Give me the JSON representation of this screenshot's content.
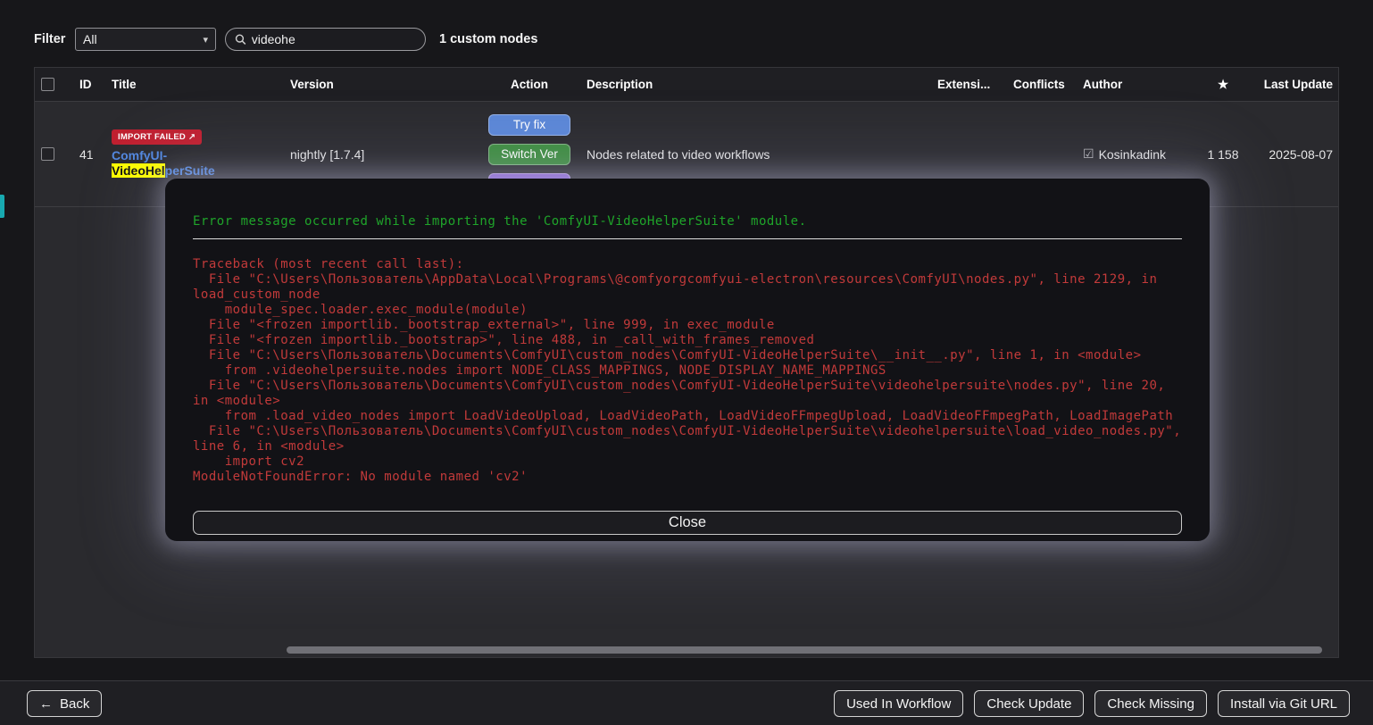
{
  "topbar": {
    "filter_label": "Filter",
    "filter_value": "All",
    "search_value": "videohe",
    "count_text": "1 custom nodes"
  },
  "table": {
    "headers": {
      "id": "ID",
      "title": "Title",
      "version": "Version",
      "action": "Action",
      "description": "Description",
      "extension": "Extensi...",
      "conflicts": "Conflicts",
      "author": "Author",
      "star": "★",
      "last_update": "Last Update"
    },
    "row": {
      "id": "41",
      "badge_label": "IMPORT FAILED",
      "badge_icon": "↗",
      "title_prefix": "ComfyUI-",
      "title_match": "VideoHel",
      "title_suffix": "perSuite",
      "version": "nightly [1.7.4]",
      "action_fix": "Try fix",
      "action_switch": "Switch Ver",
      "description": "Nodes related to video workflows",
      "author_check": "☑",
      "author": "Kosinkadink",
      "stars": "1 158",
      "last_update": "2025-08-07"
    }
  },
  "modal": {
    "error_title": "Error message occurred while importing the 'ComfyUI-VideoHelperSuite' module.",
    "traceback": "Traceback (most recent call last):\n  File \"C:\\Users\\Пользователь\\AppData\\Local\\Programs\\@comfyorgcomfyui-electron\\resources\\ComfyUI\\nodes.py\", line 2129, in load_custom_node\n    module_spec.loader.exec_module(module)\n  File \"<frozen importlib._bootstrap_external>\", line 999, in exec_module\n  File \"<frozen importlib._bootstrap>\", line 488, in _call_with_frames_removed\n  File \"C:\\Users\\Пользователь\\Documents\\ComfyUI\\custom_nodes\\ComfyUI-VideoHelperSuite\\__init__.py\", line 1, in <module>\n    from .videohelpersuite.nodes import NODE_CLASS_MAPPINGS, NODE_DISPLAY_NAME_MAPPINGS\n  File \"C:\\Users\\Пользователь\\Documents\\ComfyUI\\custom_nodes\\ComfyUI-VideoHelperSuite\\videohelpersuite\\nodes.py\", line 20, in <module>\n    from .load_video_nodes import LoadVideoUpload, LoadVideoPath, LoadVideoFFmpegUpload, LoadVideoFFmpegPath, LoadImagePath\n  File \"C:\\Users\\Пользователь\\Documents\\ComfyUI\\custom_nodes\\ComfyUI-VideoHelperSuite\\videohelpersuite\\load_video_nodes.py\", line 6, in <module>\n    import cv2\nModuleNotFoundError: No module named 'cv2'",
    "close_label": "Close"
  },
  "bottombar": {
    "back_icon": "←",
    "back_label": "Back",
    "buttons": [
      "Used In Workflow",
      "Check Update",
      "Check Missing",
      "Install via Git URL"
    ]
  },
  "colors": {
    "badge_red": "#c01f2f",
    "action_blue": "#5b87d7",
    "action_green": "#3f8e41",
    "action_purple": "#8a63d2",
    "link_blue": "#5288e0",
    "highlight_yellow": "#ffff00",
    "error_green": "#1fa52a",
    "traceback_red": "#c23a3a"
  }
}
